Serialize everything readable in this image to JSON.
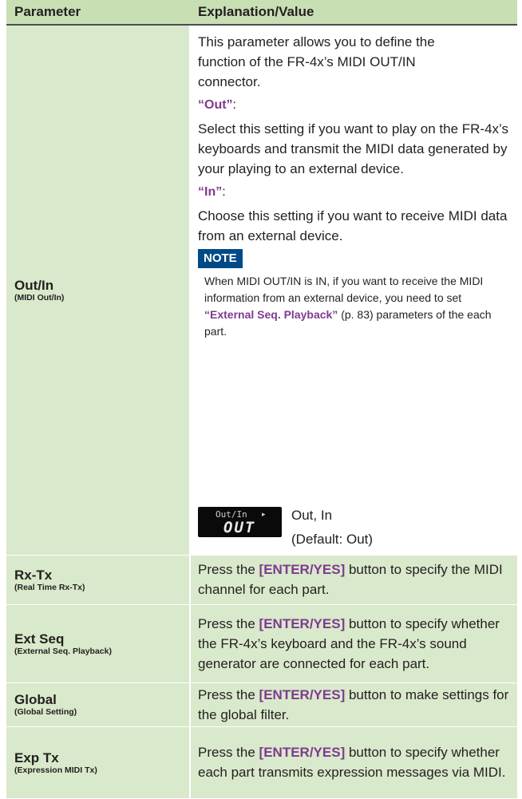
{
  "header": {
    "col1": "Parameter",
    "col2": "Explanation/Value"
  },
  "rows": [
    {
      "name": "Out/In",
      "sub": "(MIDI Out/In)",
      "intro": "This parameter allows you to define the function of the FR-4x’s MIDI OUT/IN connector.",
      "opt_out_label": "“Out”",
      "opt_out_colon": ":",
      "opt_out_text": "Select this setting if you want to play on the FR-4x’s keyboards and transmit the MIDI data generated by your playing to an external device.",
      "opt_in_label": "“In”",
      "opt_in_colon": ":",
      "opt_in_text": "Choose this setting if you want to receive MIDI data from an external device.",
      "note_badge": "NOTE",
      "note_pre": "When MIDI OUT/IN is IN, if you want to receive the MIDI information from an external device, you need to set ",
      "note_bold": "“External Seq. Playback”",
      "note_post": " (p. 83) parameters of the each part.",
      "lcd_line1": "Out/In",
      "lcd_arrow": "▸",
      "lcd_line2": "OUT",
      "values": "Out, In",
      "default": "(Default: Out)"
    },
    {
      "name": "Rx-Tx",
      "sub": "(Real Time Rx-Tx)",
      "pre": "Press the ",
      "btn": "[ENTER/YES]",
      "post": " button to specify the MIDI channel for each part."
    },
    {
      "name": "Ext Seq",
      "sub": "(External Seq. Playback)",
      "pre": "Press the ",
      "btn": "[ENTER/YES]",
      "post": " button to specify whether the FR-4x’s keyboard and the FR-4x’s sound generator are connected for each part."
    },
    {
      "name": "Global",
      "sub": "(Global Setting)",
      "pre": "Press the ",
      "btn": "[ENTER/YES]",
      "post": " button to make settings for the global filter."
    },
    {
      "name": "Exp Tx",
      "sub": "(Expression MIDI Tx)",
      "pre": "Press the ",
      "btn": "[ENTER/YES]",
      "post": " button to specify whether each part transmits expression messages via MIDI."
    }
  ],
  "colors": {
    "header_bg": "#c8dfb4",
    "name_bg": "#d9e9cb",
    "accent": "#7e3a8f",
    "note_bg": "#004b87"
  }
}
